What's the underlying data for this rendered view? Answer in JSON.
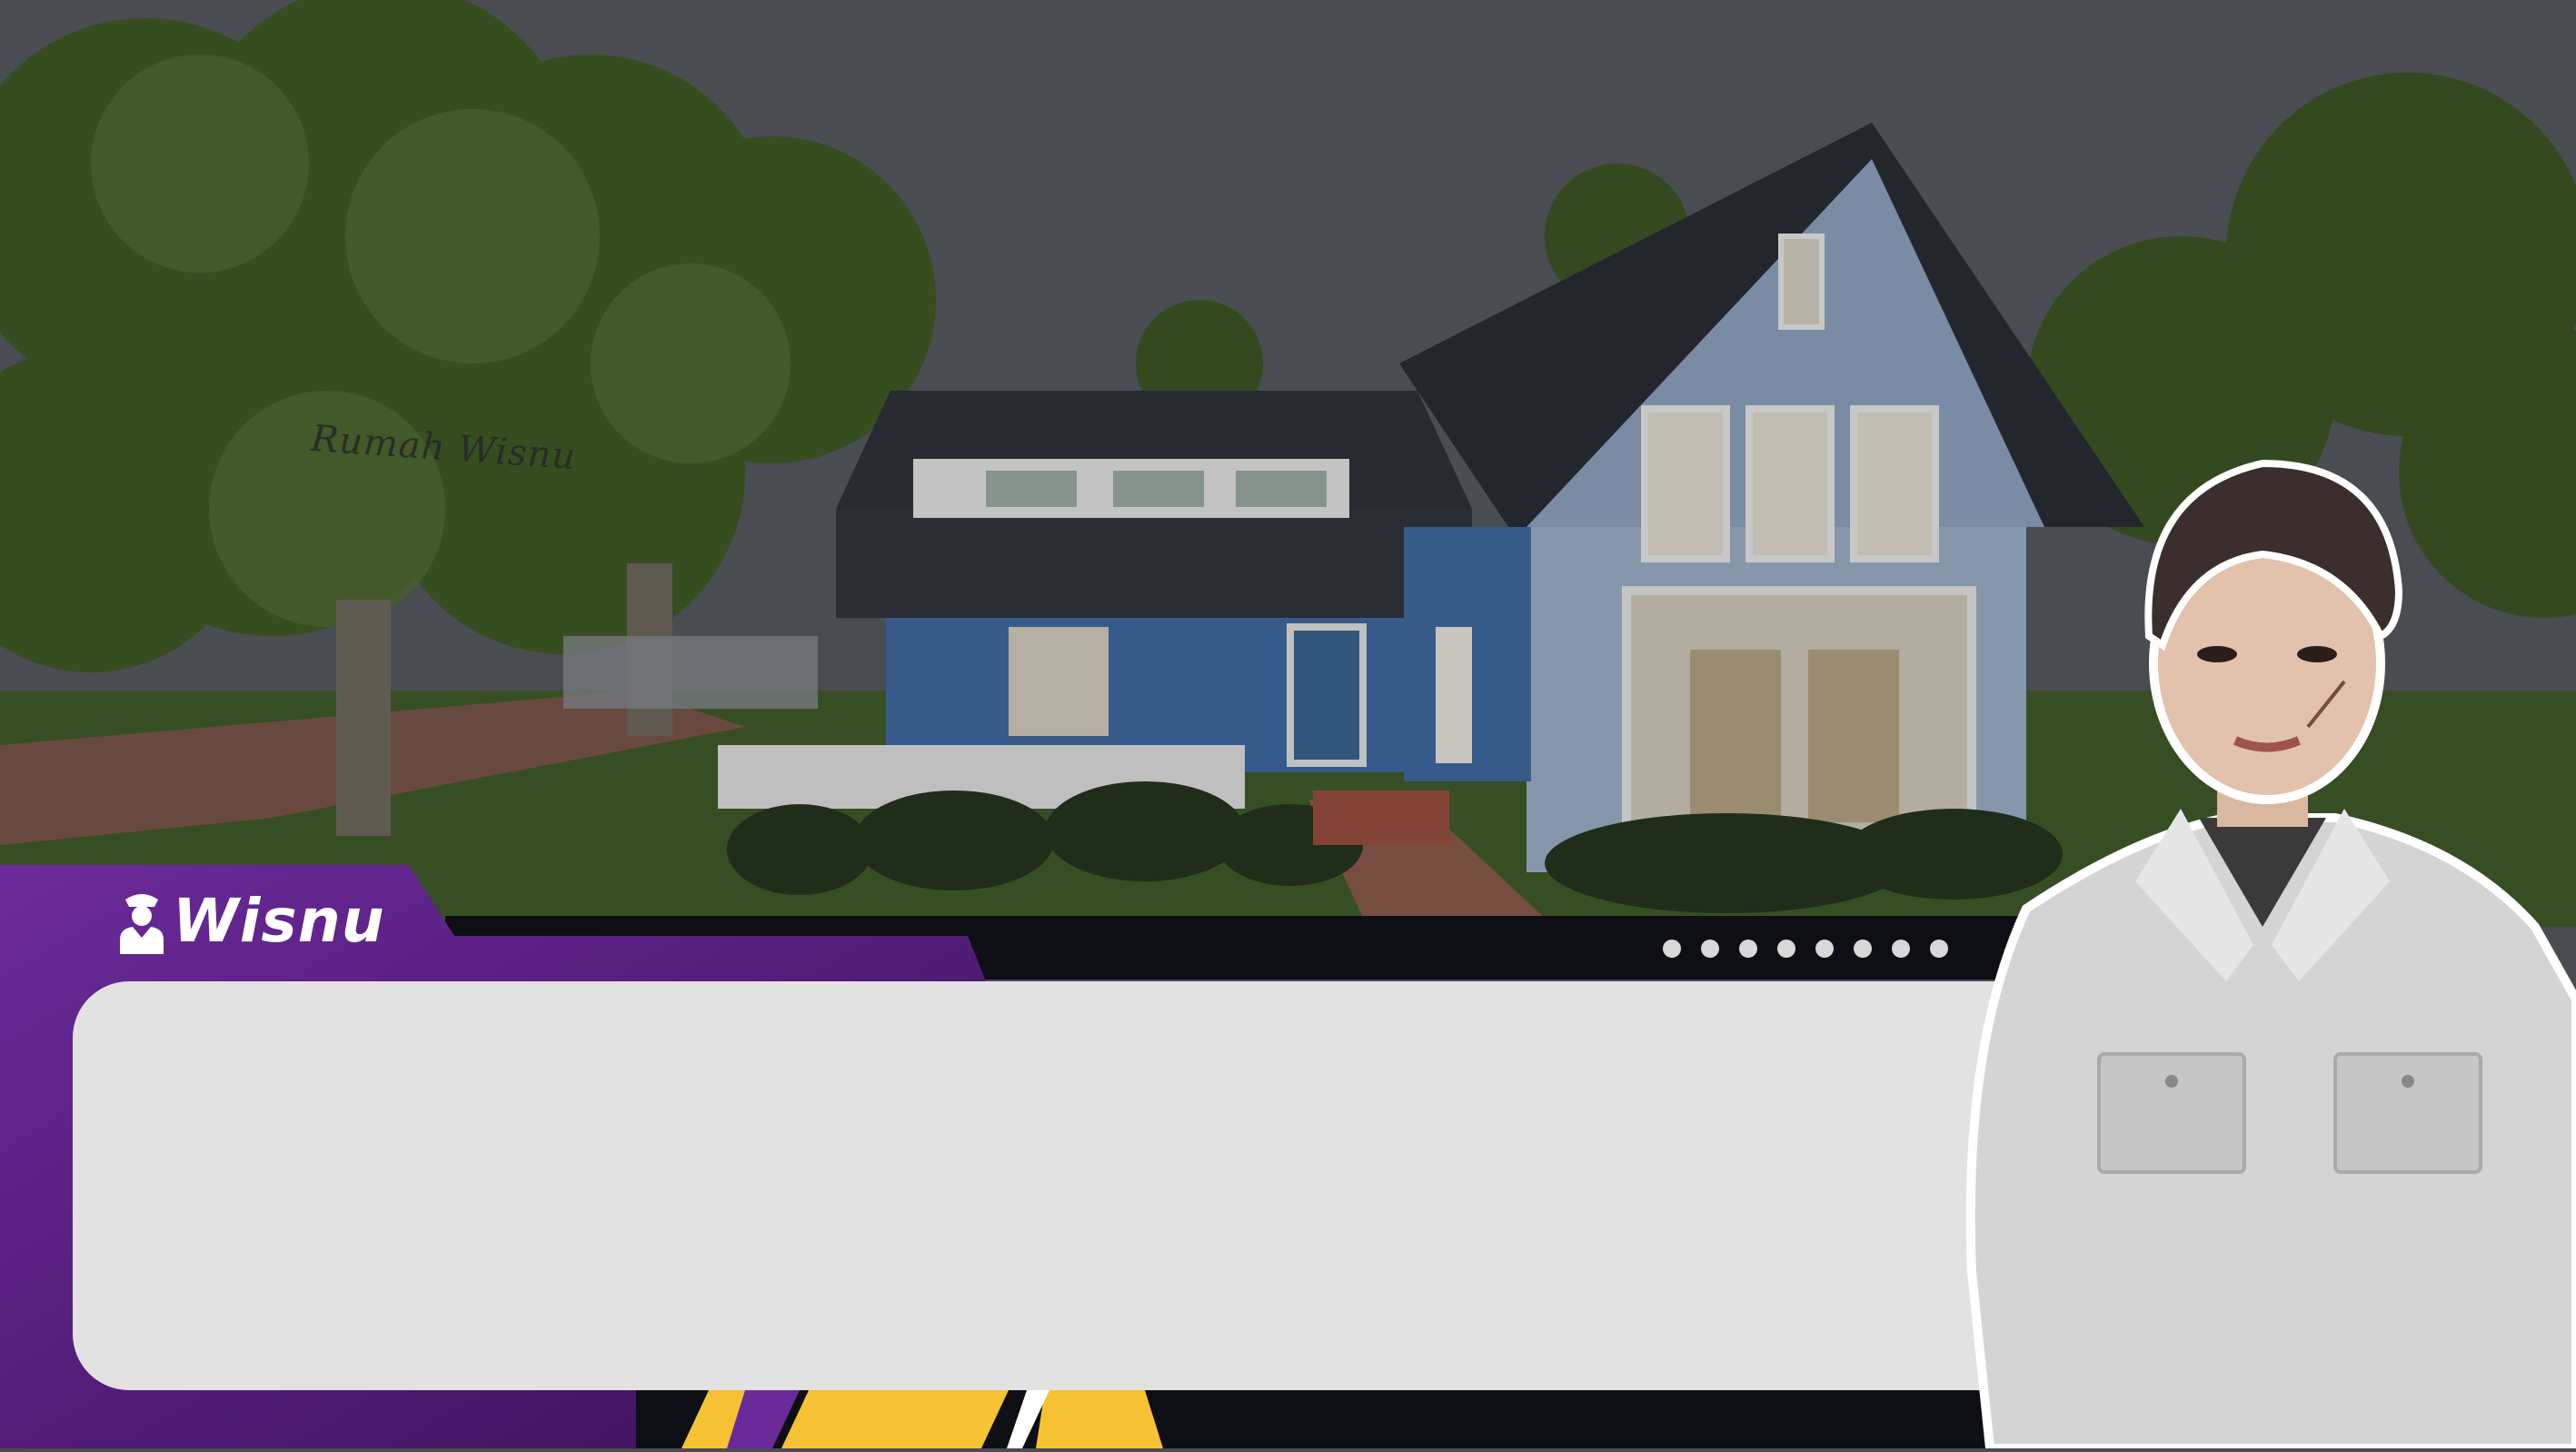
{
  "scene": {
    "location_label": "Rumah Wisnu"
  },
  "dialog": {
    "speaker_name": "Wisnu",
    "speaker_icon": "officer-icon",
    "text": "",
    "page_dots_count": 8
  },
  "colors": {
    "accent_purple": "#5b1d82",
    "accent_yellow": "#f6c233",
    "dialog_bg": "#e2e2e2",
    "bar_dark": "#0d0f14"
  },
  "character": {
    "name": "Wisnu",
    "portrait": "young-man-grey-uniform"
  }
}
